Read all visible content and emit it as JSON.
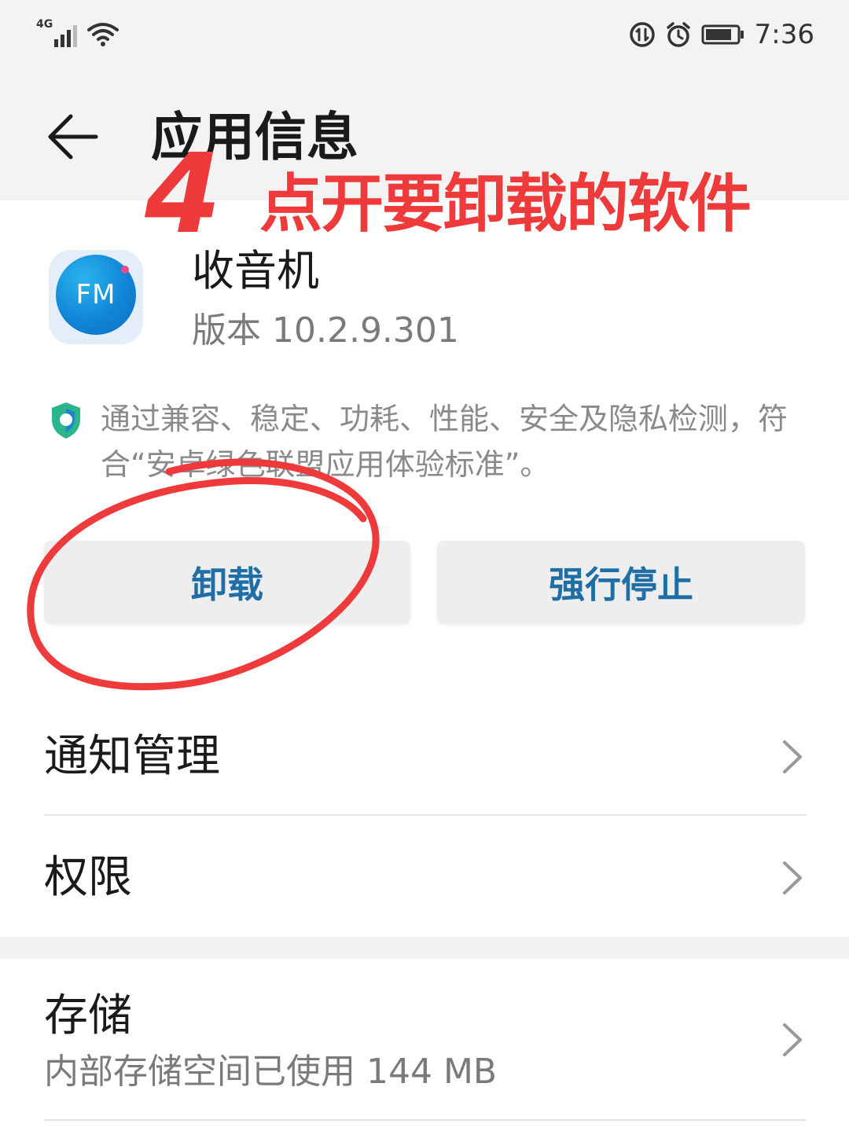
{
  "status_bar": {
    "network_type": "4G",
    "time": "7:36"
  },
  "header": {
    "title": "应用信息"
  },
  "annotation": {
    "step_number": "4",
    "text": "点开要卸载的软件"
  },
  "app": {
    "icon_label": "FM",
    "name": "收音机",
    "version": "版本 10.2.9.301"
  },
  "certification": {
    "text": "通过兼容、稳定、功耗、性能、安全及隐私检测，符合“安卓绿色联盟应用体验标准”。"
  },
  "actions": {
    "uninstall_label": "卸载",
    "force_stop_label": "强行停止"
  },
  "settings": {
    "notifications_label": "通知管理",
    "permissions_label": "权限",
    "storage_label": "存储",
    "storage_detail": "内部存储空间已使用 144 MB"
  },
  "colors": {
    "accent": "#1f6fa6",
    "annotation": "#ee3a3a",
    "background": "#ffffff",
    "header_background": "#f3f3f3"
  }
}
